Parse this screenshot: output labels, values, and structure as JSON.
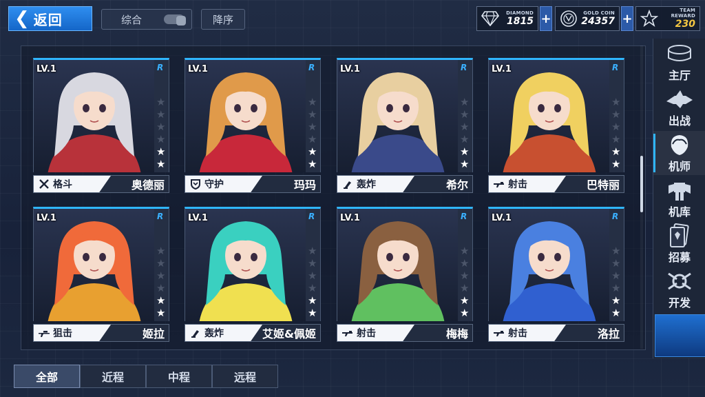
{
  "header": {
    "back_label": "返回",
    "sort_general_label": "综合",
    "sort_order_label": "降序"
  },
  "resources": {
    "diamond": {
      "caption": "DIAMOND",
      "value": "1815",
      "icon": "diamond-icon"
    },
    "gold": {
      "caption": "GOLD COIN",
      "value": "24357",
      "icon": "gold-coin-icon"
    },
    "team": {
      "caption": "TEAM REWARD",
      "value": "230",
      "icon": "team-reward-star-icon"
    },
    "plus_label": "+"
  },
  "cards": [
    {
      "level": "LV.1",
      "rarity": "R",
      "stars": 2,
      "max_stars": 6,
      "role": "格斗",
      "role_icon": "crossed-swords-icon",
      "name": "奥德丽",
      "accent": "#b8323a",
      "hair": "#d8d8e0"
    },
    {
      "level": "LV.1",
      "rarity": "R",
      "stars": 2,
      "max_stars": 6,
      "role": "守护",
      "role_icon": "shield-icon",
      "name": "玛玛",
      "accent": "#c8283a",
      "hair": "#e09a4a"
    },
    {
      "level": "LV.1",
      "rarity": "R",
      "stars": 2,
      "max_stars": 6,
      "role": "轰炸",
      "role_icon": "mortar-icon",
      "name": "希尔",
      "accent": "#3a4a8a",
      "hair": "#e8cfa0"
    },
    {
      "level": "LV.1",
      "rarity": "R",
      "stars": 2,
      "max_stars": 6,
      "role": "射击",
      "role_icon": "rifle-icon",
      "name": "巴特丽",
      "accent": "#c85030",
      "hair": "#f0d060"
    },
    {
      "level": "LV.1",
      "rarity": "R",
      "stars": 2,
      "max_stars": 6,
      "role": "狙击",
      "role_icon": "sniper-rifle-icon",
      "name": "姬拉",
      "accent": "#e8a030",
      "hair": "#f06a3a"
    },
    {
      "level": "LV.1",
      "rarity": "R",
      "stars": 2,
      "max_stars": 6,
      "role": "轰炸",
      "role_icon": "mortar-icon",
      "name": "艾姬&佩姬",
      "accent": "#f0e050",
      "hair": "#3ad0c0"
    },
    {
      "level": "LV.1",
      "rarity": "R",
      "stars": 2,
      "max_stars": 6,
      "role": "射击",
      "role_icon": "rifle-icon",
      "name": "梅梅",
      "accent": "#60c060",
      "hair": "#8a6040"
    },
    {
      "level": "LV.1",
      "rarity": "R",
      "stars": 2,
      "max_stars": 6,
      "role": "射击",
      "role_icon": "rifle-icon",
      "name": "洛拉",
      "accent": "#3060d0",
      "hair": "#4a80e0"
    }
  ],
  "right_nav": [
    {
      "label": "主厅",
      "icon": "main-hall-icon",
      "active": false
    },
    {
      "label": "出战",
      "icon": "sortie-icon",
      "active": false
    },
    {
      "label": "机师",
      "icon": "pilot-icon",
      "active": true
    },
    {
      "label": "机库",
      "icon": "hangar-icon",
      "active": false
    },
    {
      "label": "招募",
      "icon": "recruit-icon",
      "active": false
    },
    {
      "label": "开发",
      "icon": "develop-icon",
      "active": false
    }
  ],
  "bottom_tabs": [
    {
      "label": "全部",
      "active": true
    },
    {
      "label": "近程",
      "active": false
    },
    {
      "label": "中程",
      "active": false
    },
    {
      "label": "远程",
      "active": false
    }
  ]
}
